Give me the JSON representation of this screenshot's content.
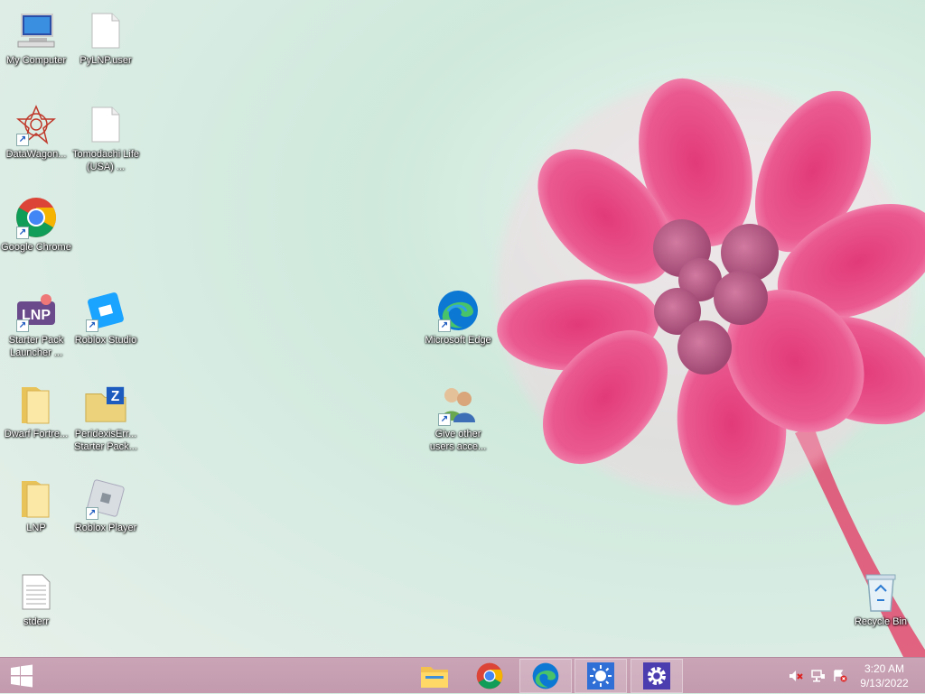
{
  "desktop": {
    "icons": [
      {
        "id": "my-computer",
        "label": "My Computer"
      },
      {
        "id": "pylnp-user",
        "label": "PyLNP.user"
      },
      {
        "id": "datawagon",
        "label": "DataWagon..."
      },
      {
        "id": "tomodachi",
        "label": "Tomodachi Life (USA) ..."
      },
      {
        "id": "google-chrome",
        "label": "Google Chrome"
      },
      {
        "id": "starter-pack",
        "label": "Starter Pack Launcher ..."
      },
      {
        "id": "roblox-studio",
        "label": "Roblox Studio"
      },
      {
        "id": "dwarf-fortress",
        "label": "Dwarf Fortre..."
      },
      {
        "id": "peridexis",
        "label": "PeridexisErr... Starter Pack..."
      },
      {
        "id": "lnp",
        "label": "LNP"
      },
      {
        "id": "roblox-player",
        "label": "Roblox Player"
      },
      {
        "id": "stderr",
        "label": "stderr"
      },
      {
        "id": "microsoft-edge",
        "label": "Microsoft Edge"
      },
      {
        "id": "give-access",
        "label": "Give other users acce..."
      },
      {
        "id": "recycle-bin",
        "label": "Recycle Bin"
      }
    ]
  },
  "taskbar": {
    "start_icon": "windows-logo-icon",
    "pinned": [
      {
        "name": "file-explorer-icon"
      },
      {
        "name": "chrome-icon"
      },
      {
        "name": "edge-icon"
      },
      {
        "name": "brightness-icon"
      },
      {
        "name": "settings-gear-icon"
      }
    ],
    "tray": {
      "icons": [
        "speaker-muted-icon",
        "network-icon",
        "action-center-alert-icon"
      ],
      "time": "3:20 AM",
      "date": "9/13/2022"
    }
  },
  "colors": {
    "taskbar": "#c8a2b3",
    "flower": "#e4437f",
    "wallpaper": "#d8ece3"
  }
}
